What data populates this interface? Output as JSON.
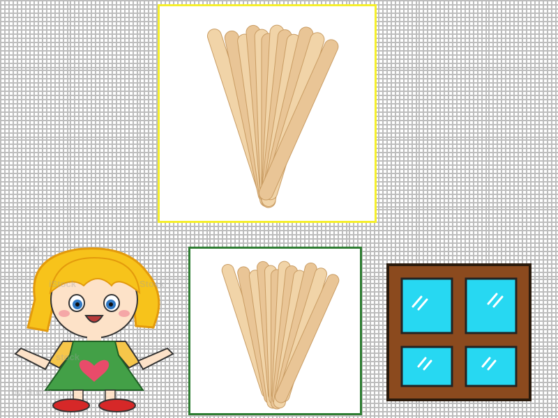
{
  "scene": {
    "background": "#ffffff",
    "grid_color": "#bdbdbd"
  },
  "cards": {
    "large": {
      "name": "popsicle-sticks-bundle-large",
      "border_color": "#f5ef2c",
      "stick_count": 12
    },
    "small": {
      "name": "popsicle-sticks-bundle-small",
      "border_color": "#2e7d32",
      "stick_count": 12
    }
  },
  "girl": {
    "watermark": [
      "istock",
      "iStock",
      "Stock",
      "stock",
      "by iStock"
    ],
    "hair_color": "#f7c31b",
    "dress_color": "#43a047",
    "shirt_color": "#f6c64a",
    "heart_color": "#e94b6a"
  },
  "window": {
    "frame_color": "#8b4a1e",
    "glass_color": "#27d8f2",
    "panes": 4
  }
}
